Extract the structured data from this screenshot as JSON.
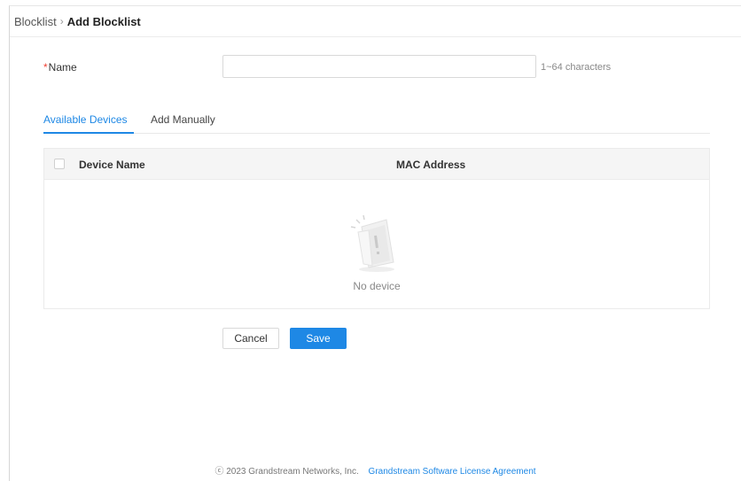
{
  "breadcrumb": {
    "parent": "Blocklist",
    "separator": "›",
    "current": "Add Blocklist"
  },
  "form": {
    "required_marker": "*",
    "name_label": "Name",
    "name_value": "",
    "name_hint": "1~64 characters"
  },
  "tabs": [
    {
      "label": "Available Devices",
      "active": true
    },
    {
      "label": "Add Manually",
      "active": false
    }
  ],
  "table": {
    "columns": [
      "Device Name",
      "MAC Address"
    ],
    "rows": [],
    "empty_text": "No device",
    "empty_icon": "empty-box-icon"
  },
  "actions": {
    "cancel_label": "Cancel",
    "save_label": "Save"
  },
  "footer": {
    "copyright": "ⓒ 2023 Grandstream Networks, Inc.",
    "license_link": "Grandstream Software License Agreement"
  },
  "colors": {
    "accent": "#1e88e5",
    "required": "#f04134"
  }
}
